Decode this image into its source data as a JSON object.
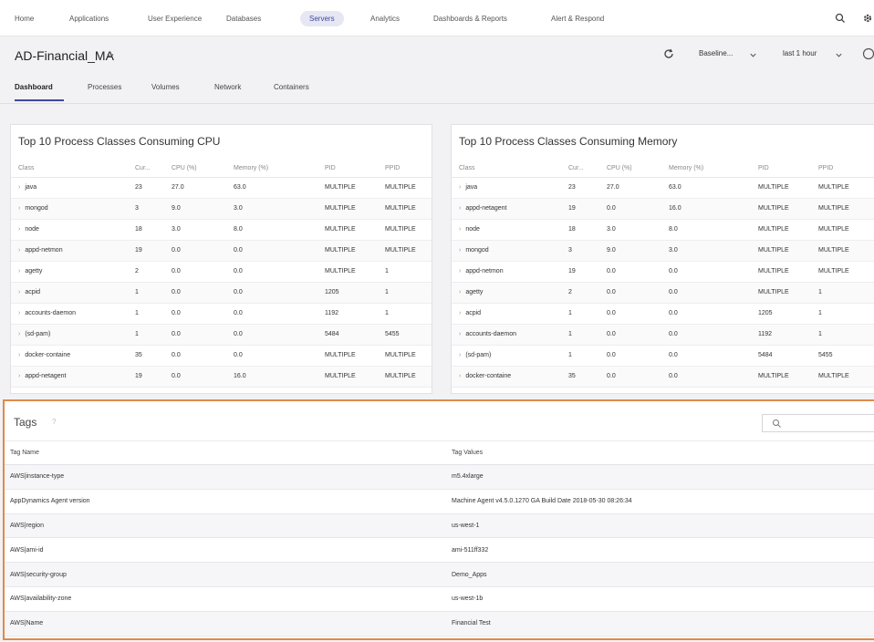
{
  "nav": {
    "items": [
      "Home",
      "Applications",
      "User Experience",
      "Databases",
      "Servers",
      "Analytics",
      "Dashboards & Reports",
      "Alert & Respond"
    ],
    "active": "Servers"
  },
  "header": {
    "title": "AD-Financial_MA",
    "baseline": "Baseline...",
    "time_range": "last 1 hour"
  },
  "subtabs": [
    "Dashboard",
    "Processes",
    "Volumes",
    "Network",
    "Containers"
  ],
  "cpu_panel": {
    "title": "Top 10 Process Classes Consuming CPU",
    "columns": [
      "Class",
      "Cur...",
      "CPU (%)",
      "Memory (%)",
      "PID",
      "PPID"
    ],
    "rows": [
      [
        "java",
        "23",
        "27.0",
        "63.0",
        "MULTIPLE",
        "MULTIPLE"
      ],
      [
        "mongod",
        "3",
        "9.0",
        "3.0",
        "MULTIPLE",
        "MULTIPLE"
      ],
      [
        "node",
        "18",
        "3.0",
        "8.0",
        "MULTIPLE",
        "MULTIPLE"
      ],
      [
        "appd-netmon",
        "19",
        "0.0",
        "0.0",
        "MULTIPLE",
        "MULTIPLE"
      ],
      [
        "agetty",
        "2",
        "0.0",
        "0.0",
        "MULTIPLE",
        "1"
      ],
      [
        "acpid",
        "1",
        "0.0",
        "0.0",
        "1205",
        "1"
      ],
      [
        "accounts-daemon",
        "1",
        "0.0",
        "0.0",
        "1192",
        "1"
      ],
      [
        "(sd-pam)",
        "1",
        "0.0",
        "0.0",
        "5484",
        "5455"
      ],
      [
        "docker-containe",
        "35",
        "0.0",
        "0.0",
        "MULTIPLE",
        "MULTIPLE"
      ],
      [
        "appd-netagent",
        "19",
        "0.0",
        "16.0",
        "MULTIPLE",
        "MULTIPLE"
      ]
    ]
  },
  "mem_panel": {
    "title": "Top 10 Process Classes Consuming Memory",
    "columns": [
      "Class",
      "Cur...",
      "CPU (%)",
      "Memory (%)",
      "PID",
      "PPID"
    ],
    "rows": [
      [
        "java",
        "23",
        "27.0",
        "63.0",
        "MULTIPLE",
        "MULTIPLE"
      ],
      [
        "appd-netagent",
        "19",
        "0.0",
        "16.0",
        "MULTIPLE",
        "MULTIPLE"
      ],
      [
        "node",
        "18",
        "3.0",
        "8.0",
        "MULTIPLE",
        "MULTIPLE"
      ],
      [
        "mongod",
        "3",
        "9.0",
        "3.0",
        "MULTIPLE",
        "MULTIPLE"
      ],
      [
        "appd-netmon",
        "19",
        "0.0",
        "0.0",
        "MULTIPLE",
        "MULTIPLE"
      ],
      [
        "agetty",
        "2",
        "0.0",
        "0.0",
        "MULTIPLE",
        "1"
      ],
      [
        "acpid",
        "1",
        "0.0",
        "0.0",
        "1205",
        "1"
      ],
      [
        "accounts-daemon",
        "1",
        "0.0",
        "0.0",
        "1192",
        "1"
      ],
      [
        "(sd-pam)",
        "1",
        "0.0",
        "0.0",
        "5484",
        "5455"
      ],
      [
        "docker-containe",
        "35",
        "0.0",
        "0.0",
        "MULTIPLE",
        "MULTIPLE"
      ]
    ]
  },
  "tags": {
    "title": "Tags",
    "help": "?",
    "search_placeholder": "",
    "columns": [
      "Tag Name",
      "Tag Values"
    ],
    "rows": [
      [
        "AWS|instance-type",
        "m5.4xlarge"
      ],
      [
        "AppDynamics Agent version",
        "Machine Agent v4.5.0.1270 GA Build Date 2018-05-30 08:26:34"
      ],
      [
        "AWS|region",
        "us-west-1"
      ],
      [
        "AWS|ami-id",
        "ami-511ff332"
      ],
      [
        "AWS|security-group",
        "Demo_Apps"
      ],
      [
        "AWS|availability-zone",
        "us-west-1b"
      ],
      [
        "AWS|Name",
        "Financial Test"
      ]
    ]
  },
  "colors": {
    "accent": "#3d4a9c",
    "highlight_border": "#e08a4a"
  },
  "icons": [
    "search-icon",
    "gear-icon",
    "chevron-down-icon",
    "refresh-icon",
    "help-icon",
    "expand-icon"
  ]
}
